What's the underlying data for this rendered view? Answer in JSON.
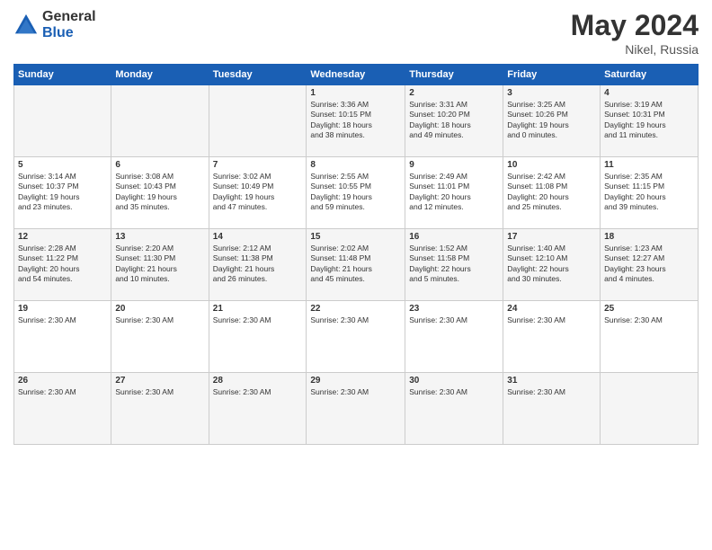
{
  "logo": {
    "general": "General",
    "blue": "Blue"
  },
  "title": {
    "month_year": "May 2024",
    "location": "Nikel, Russia"
  },
  "days_of_week": [
    "Sunday",
    "Monday",
    "Tuesday",
    "Wednesday",
    "Thursday",
    "Friday",
    "Saturday"
  ],
  "weeks": [
    [
      {
        "day": "",
        "info": ""
      },
      {
        "day": "",
        "info": ""
      },
      {
        "day": "",
        "info": ""
      },
      {
        "day": "1",
        "info": "Sunrise: 3:36 AM\nSunset: 10:15 PM\nDaylight: 18 hours\nand 38 minutes."
      },
      {
        "day": "2",
        "info": "Sunrise: 3:31 AM\nSunset: 10:20 PM\nDaylight: 18 hours\nand 49 minutes."
      },
      {
        "day": "3",
        "info": "Sunrise: 3:25 AM\nSunset: 10:26 PM\nDaylight: 19 hours\nand 0 minutes."
      },
      {
        "day": "4",
        "info": "Sunrise: 3:19 AM\nSunset: 10:31 PM\nDaylight: 19 hours\nand 11 minutes."
      }
    ],
    [
      {
        "day": "5",
        "info": "Sunrise: 3:14 AM\nSunset: 10:37 PM\nDaylight: 19 hours\nand 23 minutes."
      },
      {
        "day": "6",
        "info": "Sunrise: 3:08 AM\nSunset: 10:43 PM\nDaylight: 19 hours\nand 35 minutes."
      },
      {
        "day": "7",
        "info": "Sunrise: 3:02 AM\nSunset: 10:49 PM\nDaylight: 19 hours\nand 47 minutes."
      },
      {
        "day": "8",
        "info": "Sunrise: 2:55 AM\nSunset: 10:55 PM\nDaylight: 19 hours\nand 59 minutes."
      },
      {
        "day": "9",
        "info": "Sunrise: 2:49 AM\nSunset: 11:01 PM\nDaylight: 20 hours\nand 12 minutes."
      },
      {
        "day": "10",
        "info": "Sunrise: 2:42 AM\nSunset: 11:08 PM\nDaylight: 20 hours\nand 25 minutes."
      },
      {
        "day": "11",
        "info": "Sunrise: 2:35 AM\nSunset: 11:15 PM\nDaylight: 20 hours\nand 39 minutes."
      }
    ],
    [
      {
        "day": "12",
        "info": "Sunrise: 2:28 AM\nSunset: 11:22 PM\nDaylight: 20 hours\nand 54 minutes."
      },
      {
        "day": "13",
        "info": "Sunrise: 2:20 AM\nSunset: 11:30 PM\nDaylight: 21 hours\nand 10 minutes."
      },
      {
        "day": "14",
        "info": "Sunrise: 2:12 AM\nSunset: 11:38 PM\nDaylight: 21 hours\nand 26 minutes."
      },
      {
        "day": "15",
        "info": "Sunrise: 2:02 AM\nSunset: 11:48 PM\nDaylight: 21 hours\nand 45 minutes."
      },
      {
        "day": "16",
        "info": "Sunrise: 1:52 AM\nSunset: 11:58 PM\nDaylight: 22 hours\nand 5 minutes."
      },
      {
        "day": "17",
        "info": "Sunrise: 1:40 AM\nSunset: 12:10 AM\nDaylight: 22 hours\nand 30 minutes."
      },
      {
        "day": "18",
        "info": "Sunrise: 1:23 AM\nSunset: 12:27 AM\nDaylight: 23 hours\nand 4 minutes."
      }
    ],
    [
      {
        "day": "19",
        "info": "Sunrise: 2:30 AM"
      },
      {
        "day": "20",
        "info": "Sunrise: 2:30 AM"
      },
      {
        "day": "21",
        "info": "Sunrise: 2:30 AM"
      },
      {
        "day": "22",
        "info": "Sunrise: 2:30 AM"
      },
      {
        "day": "23",
        "info": "Sunrise: 2:30 AM"
      },
      {
        "day": "24",
        "info": "Sunrise: 2:30 AM"
      },
      {
        "day": "25",
        "info": "Sunrise: 2:30 AM"
      }
    ],
    [
      {
        "day": "26",
        "info": "Sunrise: 2:30 AM"
      },
      {
        "day": "27",
        "info": "Sunrise: 2:30 AM"
      },
      {
        "day": "28",
        "info": "Sunrise: 2:30 AM"
      },
      {
        "day": "29",
        "info": "Sunrise: 2:30 AM"
      },
      {
        "day": "30",
        "info": "Sunrise: 2:30 AM"
      },
      {
        "day": "31",
        "info": "Sunrise: 2:30 AM"
      },
      {
        "day": "",
        "info": ""
      }
    ]
  ]
}
